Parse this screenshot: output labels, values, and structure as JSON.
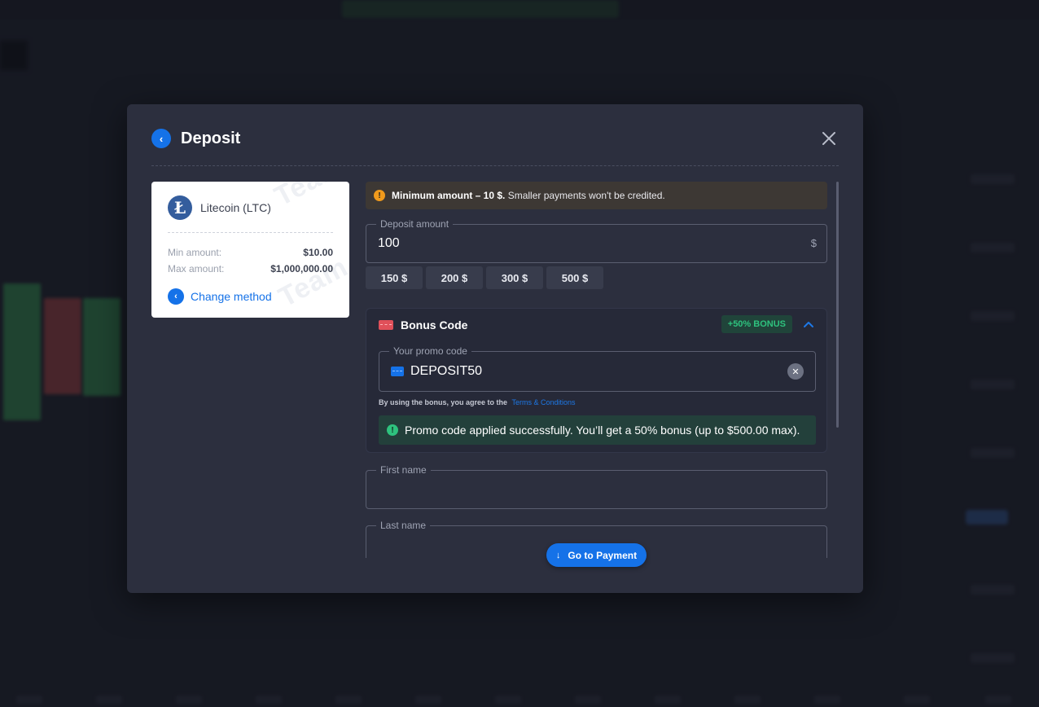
{
  "modal": {
    "title": "Deposit"
  },
  "method": {
    "name": "Litecoin (LTC)",
    "icon_glyph": "Ł",
    "watermark": "Team",
    "min_label": "Min amount:",
    "min_value": "$10.00",
    "max_label": "Max amount:",
    "max_value": "$1,000,000.00",
    "change_label": "Change method"
  },
  "warning": {
    "strong": "Minimum amount – 10 $.",
    "text": " Smaller payments won't be credited.",
    "icon": "!"
  },
  "amount": {
    "legend": "Deposit amount",
    "value": "100",
    "currency": "$",
    "presets": [
      "150 $",
      "200 $",
      "300 $",
      "500 $"
    ]
  },
  "bonus": {
    "title": "Bonus Code",
    "badge": "+50% BONUS",
    "promo_legend": "Your promo code",
    "promo_value": "DEPOSIT50",
    "terms_text": "By using the bonus, you agree to the",
    "terms_link": "Terms & Conditions",
    "success_text": "Promo code applied successfully. You’ll get a 50% bonus (up to $500.00 max).",
    "success_icon": "!"
  },
  "fields": {
    "first_name_legend": "First name",
    "last_name_legend": "Last name"
  },
  "actions": {
    "go_to_payment": "Go to Payment"
  },
  "colors": {
    "accent": "#1572e8",
    "success": "#2ec27e",
    "warning": "#f09a1c",
    "modal_bg": "#2c2f3e"
  }
}
